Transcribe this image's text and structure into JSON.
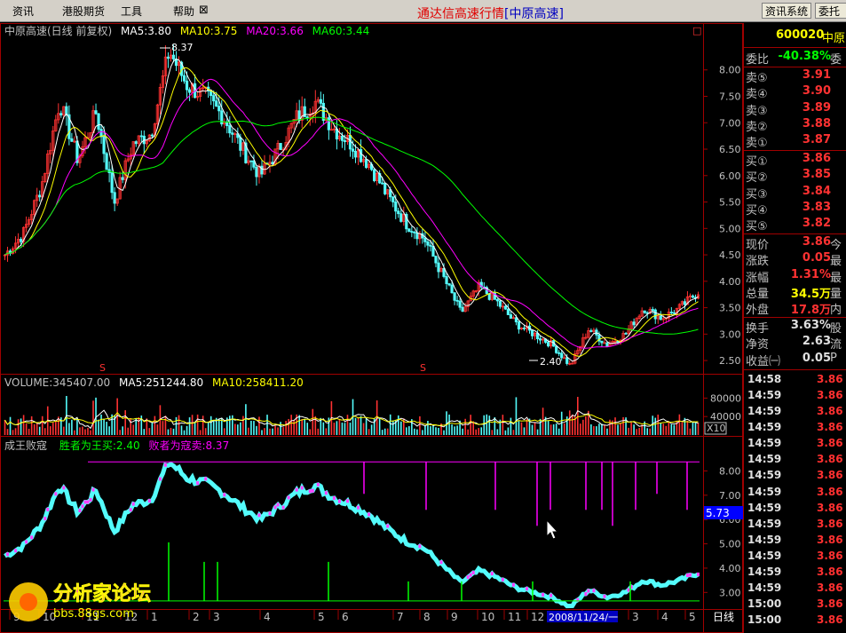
{
  "menu": {
    "items": [
      "资讯",
      "港股期货",
      "工具",
      "帮助"
    ],
    "close_glyph": "⊠"
  },
  "app_title": {
    "main": "通达信高速行情",
    "sub": "[中原高速]"
  },
  "sys_buttons": [
    "资讯系统",
    "委托"
  ],
  "main_panel": {
    "header": "中原高速(日线 前复权)",
    "ma5": "MA5:3.80",
    "ma10": "MA10:3.75",
    "ma20": "MA20:3.66",
    "ma60": "MA60:3.44",
    "high_label": "8.37",
    "low_label": "2.40",
    "flag_glyph": "S",
    "box_glyph": "□"
  },
  "volume_panel": {
    "header": "VOLUME:345407.00",
    "ma5": "MA5:251244.80",
    "ma10": "MA10:258411.20",
    "unit_label": "X10"
  },
  "indicator_panel": {
    "name": "成王败寇",
    "line1": "胜者为王买:2.40",
    "line2": "败者为寇卖:8.37",
    "current_value": "5.73"
  },
  "x_axis": {
    "labels": [
      "9",
      "10",
      "11",
      "12",
      "1",
      "2",
      "3",
      "4",
      "5",
      "6",
      "7",
      "8",
      "9",
      "10",
      "11",
      "12",
      "2",
      "3",
      "4",
      "5"
    ],
    "highlight_date": "2008/11/24/一",
    "period_label": "日线"
  },
  "chart_data": [
    {
      "type": "candlestick",
      "yaxis_ticks": [
        "8.00",
        "7.50",
        "7.00",
        "6.50",
        "6.00",
        "5.50",
        "5.00",
        "4.50",
        "4.00",
        "3.50",
        "3.00",
        "2.50"
      ],
      "ylim": [
        2.3,
        8.55
      ],
      "approx_close_path": [
        4.5,
        4.9,
        5.8,
        7.4,
        6.3,
        7.2,
        5.5,
        6.6,
        6.8,
        8.37,
        7.7,
        7.5,
        7.1,
        6.5,
        6.0,
        6.5,
        7.1,
        7.4,
        6.9,
        6.6,
        6.2,
        5.6,
        5.1,
        4.8,
        4.1,
        3.4,
        3.9,
        3.6,
        3.2,
        3.0,
        2.8,
        2.4,
        3.1,
        2.8,
        3.0,
        3.5,
        3.3,
        3.5,
        3.8
      ],
      "series": [
        {
          "name": "MA5",
          "last": 3.8
        },
        {
          "name": "MA10",
          "last": 3.75
        },
        {
          "name": "MA20",
          "last": 3.66
        },
        {
          "name": "MA60",
          "last": 3.44
        }
      ],
      "colors": {
        "up": "#ff3232",
        "down": "#54fcfc",
        "ma5": "#ffffff",
        "ma10": "#ffff00",
        "ma20": "#ff00ff",
        "ma60": "#00ff00"
      }
    },
    {
      "type": "bar",
      "yaxis_ticks": [
        "80000",
        "40000"
      ],
      "ylim": [
        0,
        100000
      ],
      "last_volume": 345407,
      "ma5": 251244.8,
      "ma10": 258411.2
    },
    {
      "type": "line",
      "yaxis_ticks": [
        "8.00",
        "7.00",
        "6.00",
        "5.00",
        "4.00",
        "3.00"
      ],
      "ylim": [
        2.5,
        8.6
      ],
      "current_value": 5.73
    }
  ],
  "side_panel": {
    "code": "600020",
    "name": "中原",
    "rows": [
      {
        "label": "委比",
        "value": "-40.38%",
        "ext": "委",
        "color": "#00ff00"
      },
      {
        "label": "卖⑤",
        "value": "3.91",
        "ext": "",
        "color": "#ff3232"
      },
      {
        "label": "卖④",
        "value": "3.90",
        "ext": "",
        "color": "#ff3232"
      },
      {
        "label": "卖③",
        "value": "3.89",
        "ext": "",
        "color": "#ff3232"
      },
      {
        "label": "卖②",
        "value": "3.88",
        "ext": "",
        "color": "#ff3232"
      },
      {
        "label": "卖①",
        "value": "3.87",
        "ext": "",
        "color": "#ff3232"
      },
      {
        "label": "买①",
        "value": "3.86",
        "ext": "",
        "color": "#ff3232"
      },
      {
        "label": "买②",
        "value": "3.85",
        "ext": "",
        "color": "#ff3232"
      },
      {
        "label": "买③",
        "value": "3.84",
        "ext": "",
        "color": "#ff3232"
      },
      {
        "label": "买④",
        "value": "3.83",
        "ext": "",
        "color": "#ff3232"
      },
      {
        "label": "买⑤",
        "value": "3.82",
        "ext": "",
        "color": "#ff3232"
      },
      {
        "label": "现价",
        "value": "3.86",
        "ext": "今",
        "color": "#ff3232"
      },
      {
        "label": "涨跌",
        "value": "0.05",
        "ext": "最",
        "color": "#ff3232"
      },
      {
        "label": "涨幅",
        "value": "1.31%",
        "ext": "最",
        "color": "#ff3232"
      },
      {
        "label": "总量",
        "value": "34.5万",
        "ext": "量",
        "color": "#ffff00"
      },
      {
        "label": "外盘",
        "value": "17.8万",
        "ext": "内",
        "color": "#ff3232"
      },
      {
        "label": "换手",
        "value": "3.63%",
        "ext": "股",
        "color": "#e0e0e0"
      },
      {
        "label": "净资",
        "value": "2.63",
        "ext": "流",
        "color": "#e0e0e0"
      },
      {
        "label": "收益㈠",
        "value": "0.05",
        "ext": "P",
        "color": "#e0e0e0"
      }
    ],
    "ticks": [
      {
        "time": "14:58",
        "price": "3.86"
      },
      {
        "time": "14:59",
        "price": "3.86"
      },
      {
        "time": "14:59",
        "price": "3.86"
      },
      {
        "time": "14:59",
        "price": "3.86"
      },
      {
        "time": "14:59",
        "price": "3.86"
      },
      {
        "time": "14:59",
        "price": "3.86"
      },
      {
        "time": "14:59",
        "price": "3.86"
      },
      {
        "time": "14:59",
        "price": "3.86"
      },
      {
        "time": "14:59",
        "price": "3.86"
      },
      {
        "time": "14:59",
        "price": "3.86"
      },
      {
        "time": "14:59",
        "price": "3.86"
      },
      {
        "time": "14:59",
        "price": "3.86"
      },
      {
        "time": "14:59",
        "price": "3.86"
      },
      {
        "time": "14:59",
        "price": "3.86"
      },
      {
        "time": "15:00",
        "price": "3.86"
      },
      {
        "time": "15:00",
        "price": "3.86"
      }
    ]
  },
  "watermark": {
    "text": "分析家论坛",
    "url": "bbs.88gs.com"
  }
}
